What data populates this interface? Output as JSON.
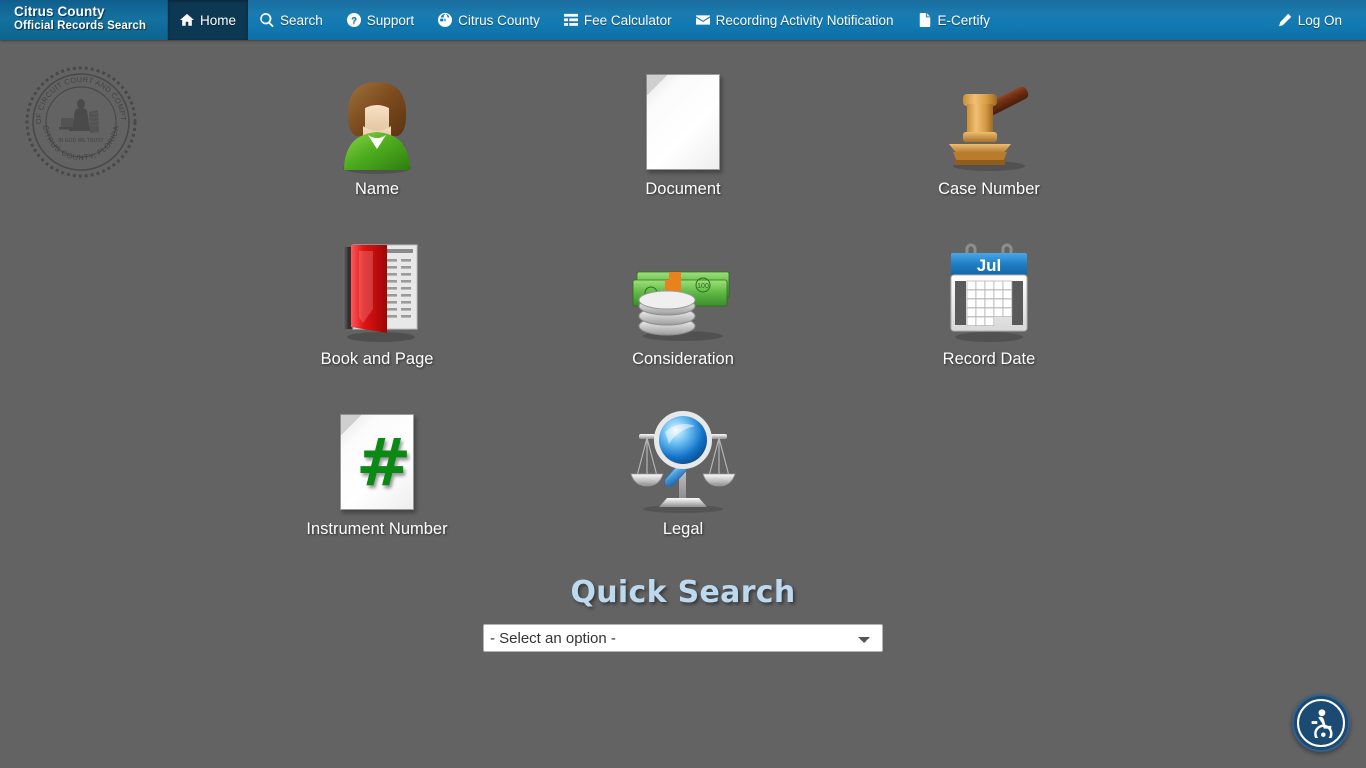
{
  "header": {
    "brand_line1": "Citrus County",
    "brand_line2": "Official Records Search",
    "nav": [
      {
        "label": "Home",
        "icon": "home-icon",
        "active": true
      },
      {
        "label": "Search",
        "icon": "search-icon",
        "active": false
      },
      {
        "label": "Support",
        "icon": "question-circle-icon",
        "active": false
      },
      {
        "label": "Citrus County",
        "icon": "globe-icon",
        "active": false
      },
      {
        "label": "Fee Calculator",
        "icon": "list-icon",
        "active": false
      },
      {
        "label": "Recording Activity Notification",
        "icon": "envelope-icon",
        "active": false
      },
      {
        "label": "E-Certify",
        "icon": "file-icon",
        "active": false
      }
    ],
    "logon_label": "Log On",
    "logon_icon": "pencil-icon",
    "nav_bg_color": "#127ab3",
    "active_tab_color": "#0d3853"
  },
  "seal": {
    "name": "county-seal",
    "top_text": "CLERK OF CIRCUIT COURT AND COMPTROLLER",
    "bottom_text": "CITRUS COUNTY, FLORIDA",
    "center_text": "IN GOD WE TRUST"
  },
  "search_tiles": [
    {
      "label": "Name",
      "icon": "person-icon"
    },
    {
      "label": "Document",
      "icon": "document-icon"
    },
    {
      "label": "Case Number",
      "icon": "gavel-icon"
    },
    {
      "label": "Book and Page",
      "icon": "book-icon"
    },
    {
      "label": "Consideration",
      "icon": "money-icon"
    },
    {
      "label": "Record Date",
      "icon": "calendar-icon"
    },
    {
      "label": "Instrument Number",
      "icon": "hash-document-icon"
    },
    {
      "label": "Legal",
      "icon": "scales-magnifier-icon"
    }
  ],
  "calendar_month": "Jul",
  "quick_search": {
    "title": "Quick Search",
    "selected_option": "- Select an option -",
    "options": [
      "- Select an option -"
    ]
  },
  "accessibility": {
    "label": "Accessibility",
    "icon": "wheelchair-icon",
    "color": "#1b4a73"
  },
  "colors": {
    "page_background": "#636363",
    "quick_title": "#bcd9f0",
    "tile_label": "#ffffff"
  }
}
